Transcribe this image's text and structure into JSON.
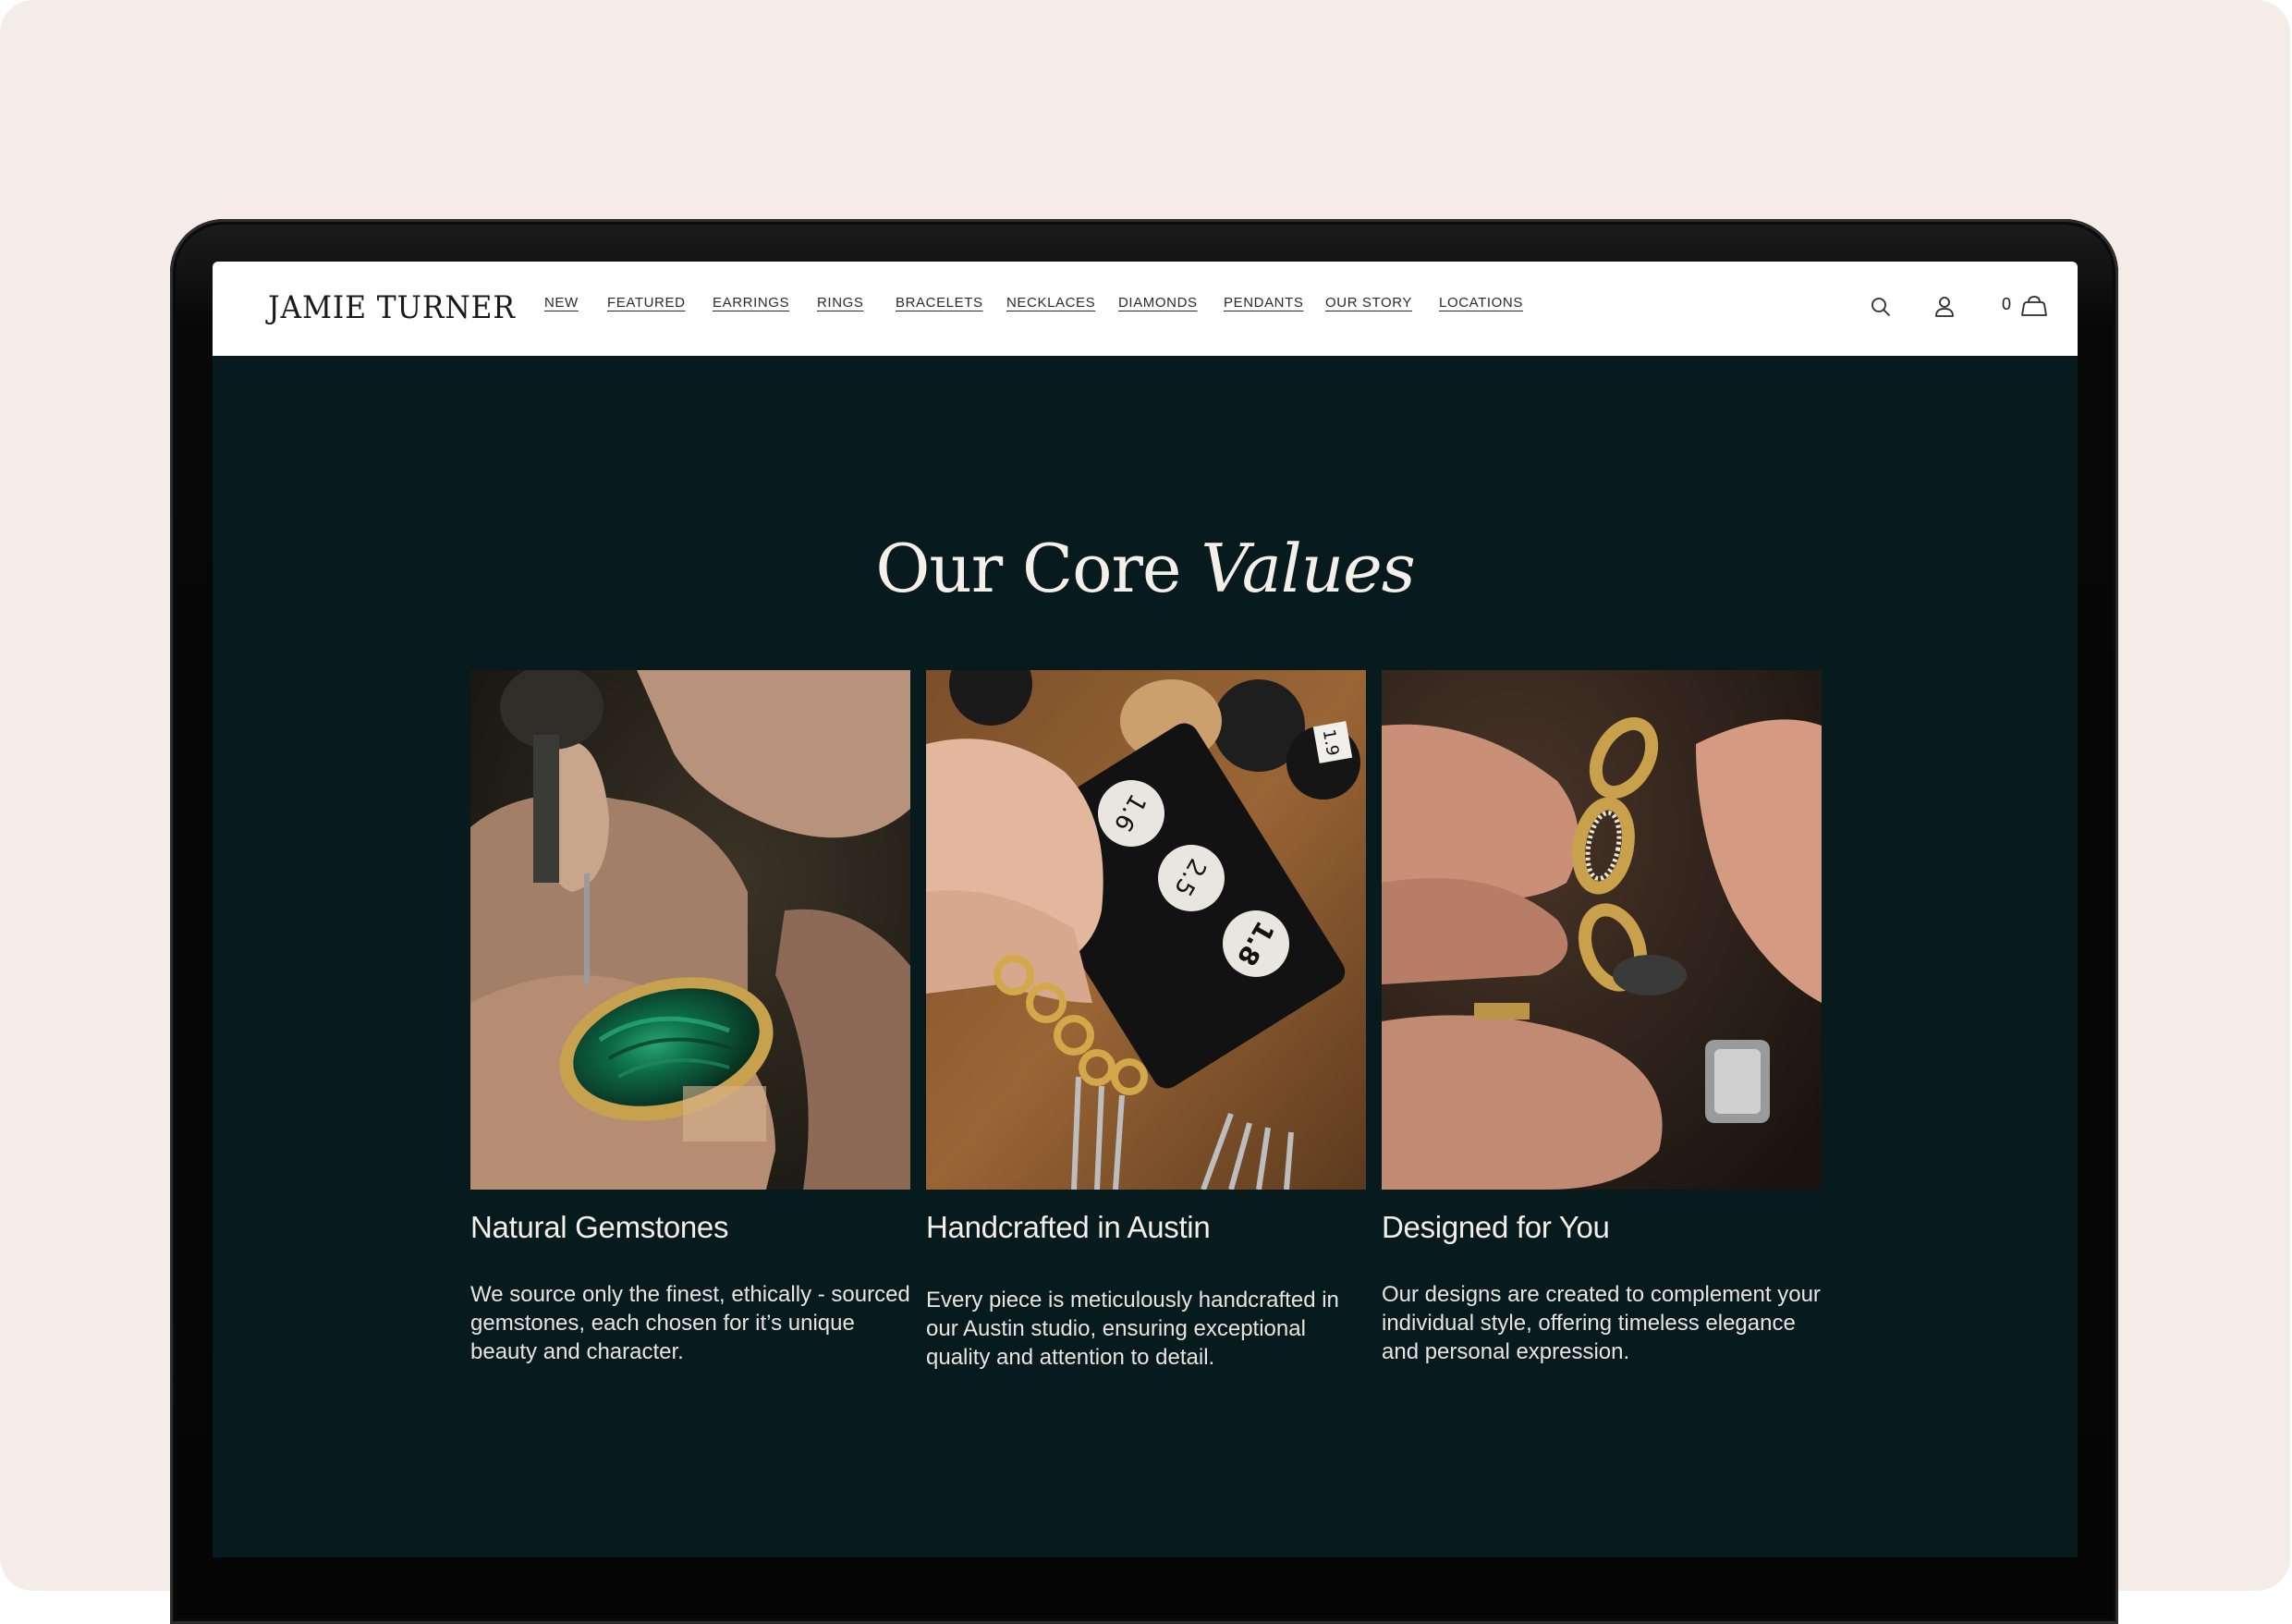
{
  "site": {
    "brand": "JAMIE TURNER",
    "nav": [
      "NEW",
      "FEATURED",
      "EARRINGS",
      "RINGS",
      "BRACELETS",
      "NECKLACES",
      "DIAMONDS",
      "PENDANTS",
      "OUR STORY",
      "LOCATIONS"
    ],
    "cart_count": "0"
  },
  "icons": {
    "search": "search-icon",
    "account": "user-icon",
    "cart": "bag-icon"
  },
  "section": {
    "title_plain": "Our Core ",
    "title_italic": "Values"
  },
  "values": [
    {
      "title": "Natural Gemstones",
      "body": "We source only the finest, ethically - sourced gemstones, each chosen for it’s unique beauty and character.",
      "image": "hands setting a green malachite stone in a gold ring"
    },
    {
      "title": "Handcrafted in Austin",
      "body": "Every piece is meticulously handcrafted in our Austin studio, ensuring exceptional quality and attention to detail.",
      "image": "jeweler's workbench with gold chain, tools and labeled discs",
      "disc_labels": [
        "1.6",
        "2.5",
        "1.8",
        "1.9"
      ]
    },
    {
      "title": "Designed for You",
      "body": "Our designs are created to complement your individual style, offering timeless elegance and personal expression.",
      "image": "fingers holding a gold chain link bracelet with pavé diamonds"
    }
  ],
  "colors": {
    "page_bg": "#f5ece8",
    "section_bg": "#071a1e",
    "header_bg": "#ffffff",
    "text_light": "#f4efe9"
  }
}
